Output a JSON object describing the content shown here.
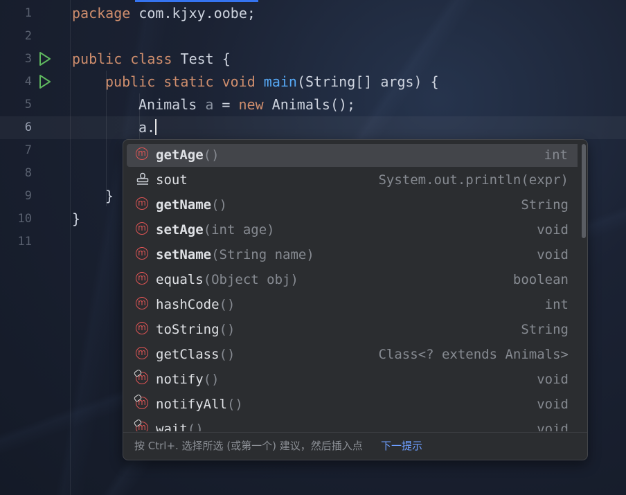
{
  "editor": {
    "line_numbers": [
      "1",
      "2",
      "3",
      "4",
      "5",
      "6",
      "7",
      "8",
      "9",
      "10",
      "11"
    ],
    "active_line": "6",
    "lines": {
      "l1": {
        "kw": "package",
        "rest": " com.kjxy.oobe;"
      },
      "l3": {
        "kw": "public class",
        "rest": " Test {"
      },
      "l4": {
        "kw": "public static void",
        "fn": "main",
        "rest": "(String[] args) {"
      },
      "l5": {
        "type": "Animals ",
        "var": "a",
        "op": " = ",
        "kw": "new",
        "rest": " Animals();"
      },
      "l6": {
        "text": "a."
      },
      "l9": {
        "text": "}"
      },
      "l10": {
        "text": "}"
      }
    }
  },
  "completion": {
    "items": [
      {
        "name": "getAge",
        "params": "()",
        "type": "int",
        "icon": "method-icon",
        "bold": true,
        "selected": true
      },
      {
        "name": "sout",
        "params": "",
        "type": "System.out.println(expr)",
        "icon": "template-stamp-icon",
        "bold": false
      },
      {
        "name": "getName",
        "params": "()",
        "type": "String",
        "icon": "method-icon",
        "bold": true
      },
      {
        "name": "setAge",
        "params": "(int age)",
        "type": "void",
        "icon": "method-icon",
        "bold": true
      },
      {
        "name": "setName",
        "params": "(String name)",
        "type": "void",
        "icon": "method-icon",
        "bold": true
      },
      {
        "name": "equals",
        "params": "(Object obj)",
        "type": "boolean",
        "icon": "method-icon",
        "bold": false
      },
      {
        "name": "hashCode",
        "params": "()",
        "type": "int",
        "icon": "method-icon",
        "bold": false
      },
      {
        "name": "toString",
        "params": "()",
        "type": "String",
        "icon": "method-icon",
        "bold": false
      },
      {
        "name": "getClass",
        "params": "()",
        "type": "Class<? extends Animals>",
        "icon": "method-icon",
        "bold": false
      },
      {
        "name": "notify",
        "params": "()",
        "type": "void",
        "icon": "final-method-icon",
        "bold": false
      },
      {
        "name": "notifyAll",
        "params": "()",
        "type": "void",
        "icon": "final-method-icon",
        "bold": false
      },
      {
        "name": "wait",
        "params": "()",
        "type": "void",
        "icon": "final-method-icon",
        "bold": false
      }
    ],
    "footer_hint": "按 Ctrl+. 选择所选 (或第一个) 建议，然后插入点",
    "footer_link": "下一提示"
  },
  "colors": {
    "keyword": "#cf8e6d",
    "function": "#56a8f5",
    "method_icon": "#e05555",
    "link": "#6d9eff",
    "run_icon": "#5fb85f"
  }
}
